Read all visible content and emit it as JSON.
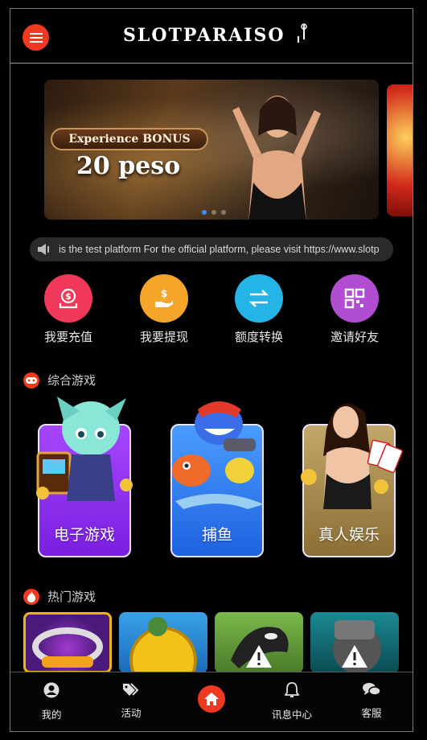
{
  "header": {
    "logo_text": "SLOTPARAISO",
    "menu_icon": "hamburger-icon"
  },
  "banner": {
    "promo_label": "Experience BONUS",
    "promo_amount": "20 peso",
    "page_count": 3,
    "active_page": 1
  },
  "notice": {
    "speaker_icon": "speaker-icon",
    "text": "is the test platform For the official platform, please visit https://www.slotp"
  },
  "actions": [
    {
      "label": "我要充值",
      "icon": "deposit-icon",
      "color": "#f0395a"
    },
    {
      "label": "我要提现",
      "icon": "withdraw-icon",
      "color": "#f4a52a"
    },
    {
      "label": "额度转换",
      "icon": "transfer-icon",
      "color": "#25b4e6"
    },
    {
      "label": "邀请好友",
      "icon": "qr-invite-icon",
      "color": "#b04dd0"
    }
  ],
  "sections": {
    "all_games": "综合游戏",
    "hot_games": "热门游戏"
  },
  "categories": [
    {
      "label": "电子游戏",
      "color": "#8f2bf2"
    },
    {
      "label": "捕鱼",
      "color": "#2e7cf2"
    },
    {
      "label": "真人娱乐",
      "color": "#a68a4a"
    }
  ],
  "hot_games": [
    {
      "name": "purple-slot-game",
      "color": "#f2b21a"
    },
    {
      "name": "gold-coin-game",
      "color": "#3aa2e8"
    },
    {
      "name": "orca-game",
      "color": "#6aa04a"
    },
    {
      "name": "mech-game",
      "color": "#16727a"
    }
  ],
  "nav": {
    "profile": "我的",
    "promotions": "活动",
    "messages": "讯息中心",
    "support": "客服"
  }
}
